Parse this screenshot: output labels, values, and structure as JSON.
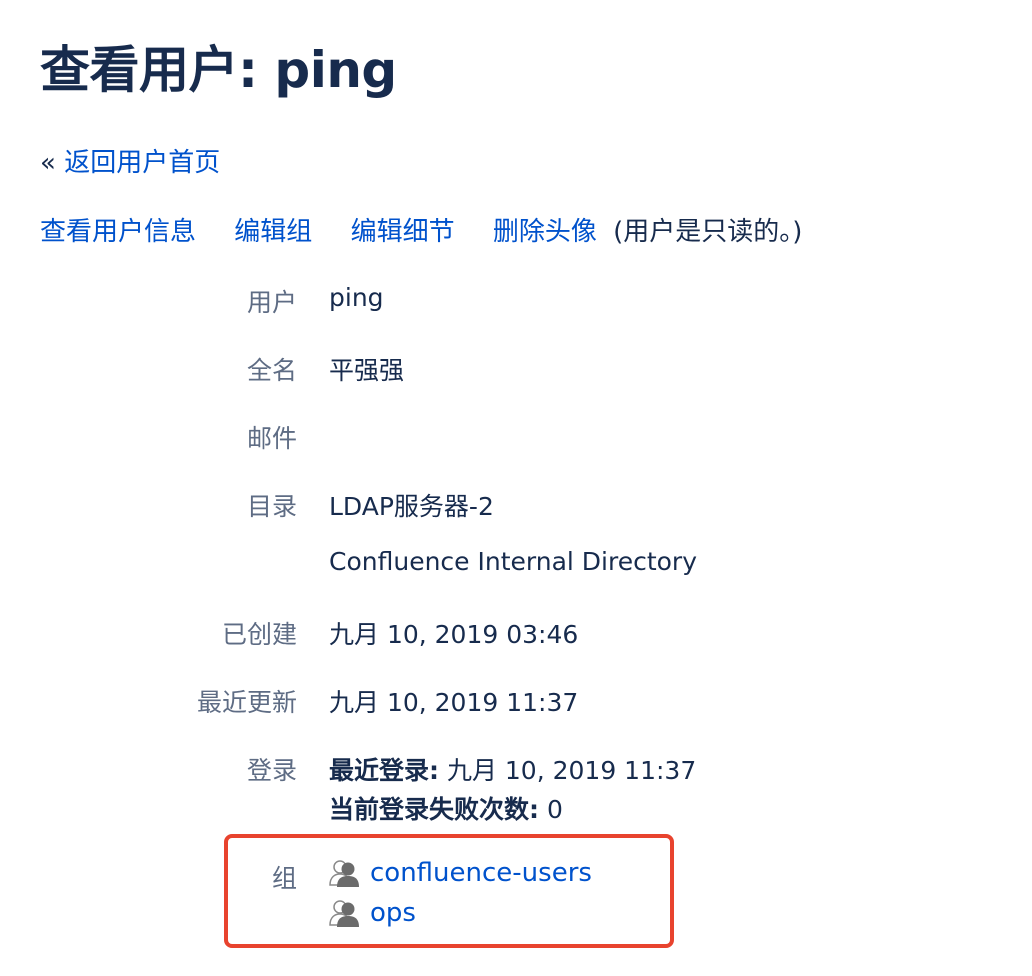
{
  "page_title": "查看用户: ping",
  "back": {
    "prefix": "«",
    "label": "返回用户首页"
  },
  "actions": {
    "view_info": "查看用户信息",
    "edit_groups": "编辑组",
    "edit_details": "编辑细节",
    "remove_avatar": "删除头像",
    "readonly_note": "(用户是只读的。)"
  },
  "details": {
    "username": {
      "label": "用户",
      "value": "ping"
    },
    "fullname": {
      "label": "全名",
      "value": "平强强"
    },
    "email": {
      "label": "邮件",
      "value": ""
    },
    "directory": {
      "label": "目录",
      "values": [
        "LDAP服务器-2",
        "Confluence Internal Directory"
      ]
    },
    "created": {
      "label": "已创建",
      "value": "九月 10, 2019 03:46"
    },
    "updated": {
      "label": "最近更新",
      "value": "九月 10, 2019 11:37"
    },
    "login": {
      "label": "登录",
      "last_login_label": "最近登录:",
      "last_login_value": "九月 10, 2019 11:37",
      "failed_label": "当前登录失败次数:",
      "failed_value": "0"
    },
    "groups": {
      "label": "组",
      "icon": "group-icon",
      "items": [
        "confluence-users",
        "ops"
      ]
    }
  },
  "colors": {
    "link": "#0052cc",
    "text": "#172b4d",
    "label": "#5e6c84",
    "highlight": "#e8432e"
  }
}
